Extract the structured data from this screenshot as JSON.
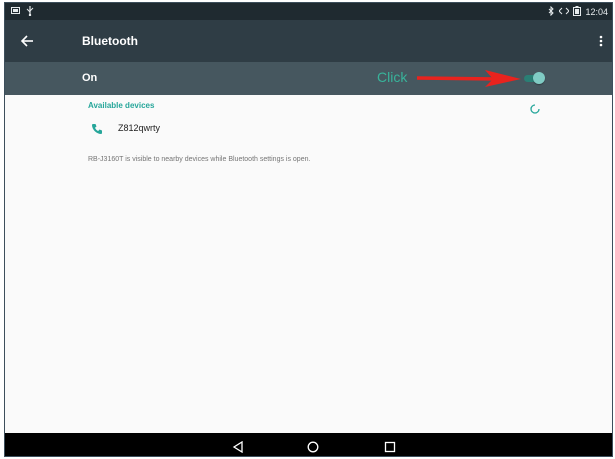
{
  "status_bar": {
    "time": "12:04",
    "icons": [
      "screenshot-icon",
      "usb-icon",
      "bluetooth-icon",
      "data-arrows-icon",
      "battery-icon"
    ]
  },
  "app_bar": {
    "title": "Bluetooth",
    "back_icon": "back-arrow-icon",
    "menu_icon": "overflow-menu-icon"
  },
  "switch_row": {
    "label": "On",
    "state": true
  },
  "annotation": {
    "label": "Click",
    "color": "#38b39a",
    "arrow_color": "#e8231e"
  },
  "available_devices": {
    "header": "Available devices",
    "scanning": true,
    "devices": [
      {
        "name": "Z812qwrty",
        "icon": "phone-icon"
      }
    ]
  },
  "visibility_note": "RB-J3160T is visible to nearby devices while Bluetooth settings is open.",
  "nav_bar": {
    "buttons": [
      "back-triangle-icon",
      "home-circle-icon",
      "recents-square-icon"
    ]
  },
  "colors": {
    "accent": "#26a69a",
    "app_bar": "#2f3d45",
    "switch_row": "#46575f"
  }
}
